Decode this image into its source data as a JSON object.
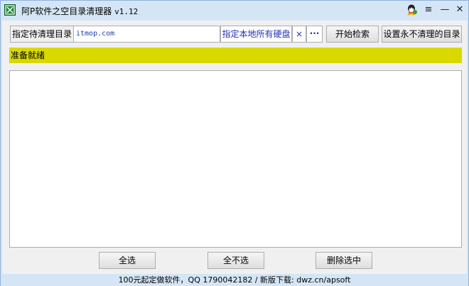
{
  "window": {
    "title": "阿P软件之空目录清理器",
    "version": "v1.12",
    "accent_color": "#d4e6f5",
    "title_buttons": {
      "qq": "qq-icon",
      "menu": "≡",
      "minimize": "—",
      "close": "✕"
    }
  },
  "toolbar": {
    "dir_label": "指定待清理目录",
    "dir_value": "itmop.com",
    "all_disks_label": "指定本地所有硬盘",
    "clear_label": "×",
    "browse_label": "···",
    "search_button": "开始检索",
    "exclude_button": "设置永不清理的目录"
  },
  "status": {
    "text": "准备就绪",
    "color": "#d9d900"
  },
  "actions": {
    "select_all": "全选",
    "select_none": "全不选",
    "delete_selected": "删除选中"
  },
  "footer": {
    "text": "100元起定做软件，QQ 1790042182 / 新版下载: dwz.cn/apsoft"
  }
}
